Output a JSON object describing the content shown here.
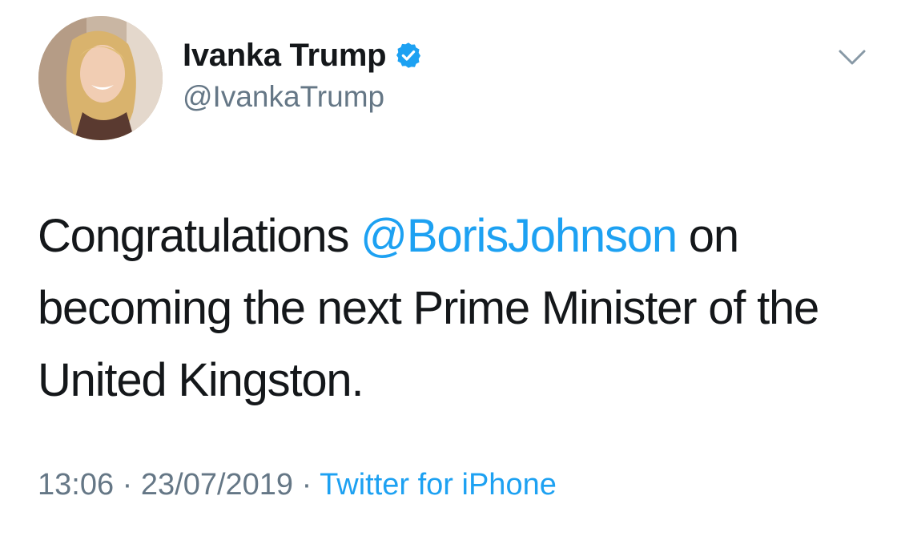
{
  "user": {
    "display_name": "Ivanka Trump",
    "handle": "@IvankaTrump",
    "verified": true,
    "avatar_icon": "profile-photo"
  },
  "menu": {
    "icon": "chevron-down-icon"
  },
  "tweet": {
    "text_before": "Congratulations ",
    "mention": "@BorisJohnson",
    "text_after": " on becoming the next Prime Minister of the United Kingston."
  },
  "meta": {
    "time": "13:06",
    "separator": " · ",
    "date": "23/07/2019",
    "source": "Twitter for iPhone"
  },
  "colors": {
    "text": "#14171a",
    "secondary": "#657786",
    "accent": "#1da1f2"
  }
}
